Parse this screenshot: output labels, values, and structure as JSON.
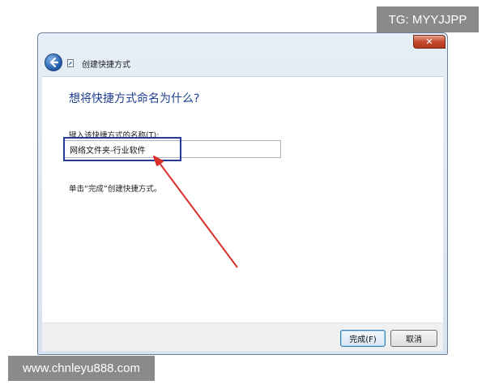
{
  "watermarks": {
    "top_right": "TG: MYYJJPP",
    "bottom_left": "www.chnleyu888.com"
  },
  "window": {
    "title": "创建快捷方式",
    "close_label": "✕",
    "heading": "想将快捷方式命名为什么?",
    "field_label": "键入该快捷方式的名称(T):",
    "name_value": "网络文件夹-行业软件",
    "hint": "单击“完成”创建快捷方式。",
    "finish_label": "完成(F)",
    "cancel_label": "取消"
  },
  "icons": {
    "back": "back-arrow-icon",
    "shortcut": "shortcut-icon",
    "close": "close-icon"
  },
  "colors": {
    "heading": "#1f3f8f",
    "highlight_box": "#233a9a",
    "annotation_arrow": "#d9302a"
  }
}
